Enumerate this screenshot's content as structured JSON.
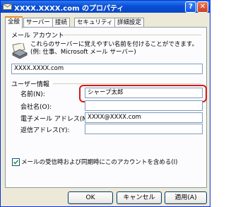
{
  "window": {
    "title": "XXXX.XXXX.com のプロパティ",
    "help_label": "?",
    "close_label": "✕"
  },
  "tabs": [
    {
      "label": "全般"
    },
    {
      "label": "サーバー"
    },
    {
      "label": "接続"
    },
    {
      "label": "セキュリティ"
    },
    {
      "label": "詳細設定"
    }
  ],
  "mail_account": {
    "section_label": "メール アカウント",
    "description": "これらのサーバーに覚えやすい名前を付けることができます。(例: 仕事、Microsoft メール サーバー)",
    "account_name": "XXXX.XXXX.com",
    "icon": "mail-account-icon"
  },
  "user_info": {
    "section_label": "ユーザー情報",
    "name_label": "名前(N):",
    "name_value": "シャープ太郎",
    "company_label": "会社名(O):",
    "company_value": "",
    "email_label": "電子メール アドレス(M):",
    "email_value": "XXXX@XXXX.com",
    "reply_label": "返信アドレス(Y):",
    "reply_value": ""
  },
  "options": {
    "include_label": "メールの受信時および同期時にこのアカウントを含める(I)",
    "include_checked": true
  },
  "buttons": {
    "ok": "OK",
    "cancel": "キャンセル",
    "apply": "適用(A)"
  },
  "colors": {
    "titlebar": "#0a4fd6",
    "highlight": "#d6181a",
    "active_tab_accent": "#e68b2c"
  }
}
